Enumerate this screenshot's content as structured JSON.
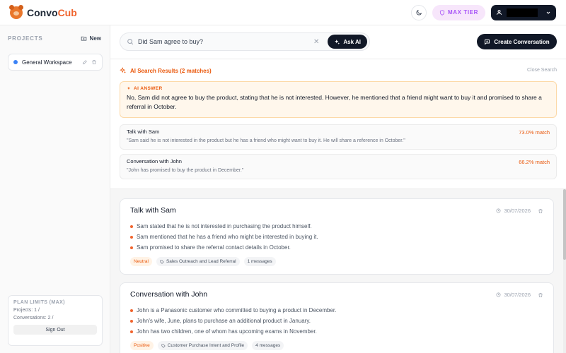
{
  "app": {
    "name_main": "Convo",
    "name_accent": "Cub"
  },
  "header": {
    "tier_label": "MAX TIER"
  },
  "sidebar": {
    "projects_title": "PROJECTS",
    "new_label": "New",
    "workspace_label": "General Workspace",
    "plan": {
      "title": "PLAN LIMITS (MAX)",
      "projects": "Projects: 1 /",
      "conversations": "Conversations: 2 /",
      "signout": "Sign Out"
    }
  },
  "search": {
    "value": "Did Sam agree to buy?",
    "ask_label": "Ask AI"
  },
  "toolbar": {
    "create_label": "Create Conversation"
  },
  "results": {
    "title": "AI Search Results (2 matches)",
    "close_label": "Close Search",
    "answer_label": "AI ANSWER",
    "answer_text": "No, Sam did not agree to buy the product, stating that he is not interested. However, he mentioned that a friend might want to buy it and promised to share a referral in October.",
    "matches": [
      {
        "title": "Talk with Sam",
        "pct": "73.0% match",
        "quote": "\"Sam said he is not interested in the product but he has a friend who might want to buy it. He will share a reference in October.\""
      },
      {
        "title": "Conversation with John",
        "pct": "66.2% match",
        "quote": "\"John has promised to buy the product in December.\""
      }
    ]
  },
  "conversations": [
    {
      "title": "Talk with Sam",
      "date": "30/07/2026",
      "bullets": [
        "Sam stated that he is not interested in purchasing the product himself.",
        "Sam mentioned that he has a friend who might be interested in buying it.",
        "Sam promised to share the referral contact details in October."
      ],
      "sentiment": "Neutral",
      "topic": "Sales Outreach and Lead Referral",
      "messages": "1 messages"
    },
    {
      "title": "Conversation with John",
      "date": "30/07/2026",
      "bullets": [
        "John is a Panasonic customer who committed to buying a product in December.",
        "John's wife, June, plans to purchase an additional product in January.",
        "John has two children, one of whom has upcoming exams in November."
      ],
      "sentiment": "Positive",
      "topic": "Customer Purchase Intent and Profile",
      "messages": "4 messages"
    }
  ],
  "colors": {
    "accent": "#f0642e",
    "dark": "#111827",
    "tier": "#a855f7"
  }
}
